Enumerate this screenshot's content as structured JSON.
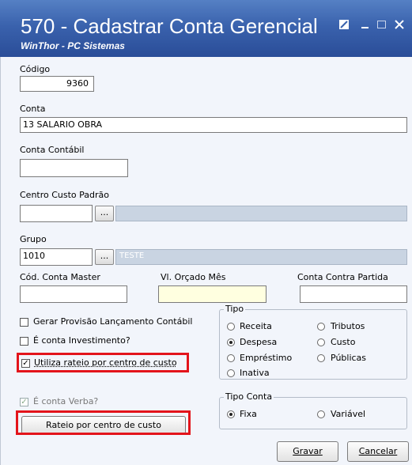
{
  "window": {
    "title": "570 - Cadastrar Conta Gerencial",
    "subtitle": "WinThor - PC Sistemas",
    "controls": [
      "edit-icon",
      "minimize-icon",
      "maximize-icon",
      "close-icon"
    ]
  },
  "fields": {
    "codigo_label": "Código",
    "codigo_value": "9360",
    "conta_label": "Conta",
    "conta_value": "13 SALARIO OBRA",
    "conta_contabil_label": "Conta Contábil",
    "conta_contabil_value": "",
    "centro_custo_label": "Centro Custo Padrão",
    "centro_custo_value": "",
    "centro_custo_desc": "",
    "grupo_label": "Grupo",
    "grupo_value": "1010",
    "grupo_desc": "TESTE",
    "lookup_button": "...",
    "cod_conta_master_label": "Cód. Conta Master",
    "cod_conta_master_value": "",
    "vl_orcado_label": "Vl. Orçado Mês",
    "vl_orcado_value": "",
    "conta_contra_label": "Conta Contra Partida",
    "conta_contra_value": ""
  },
  "checkboxes": {
    "gerar_provisao": {
      "label": "Gerar Provisão Lançamento Contábil",
      "checked": false
    },
    "conta_investimento": {
      "label": "É conta Investimento?",
      "checked": false
    },
    "utiliza_rateio": {
      "label": "Utiliza rateio por centro de custo",
      "checked": true
    },
    "conta_verba": {
      "label": "É conta Verba?",
      "checked": true
    }
  },
  "check_mark": "✓",
  "tipo": {
    "legend": "Tipo",
    "options": [
      "Receita",
      "Tributos",
      "Despesa",
      "Custo",
      "Empréstimo",
      "Públicas",
      "Inativa"
    ],
    "selected": "Despesa"
  },
  "tipo_conta": {
    "legend": "Tipo Conta",
    "options": [
      "Fixa",
      "Variável"
    ],
    "selected": "Fixa"
  },
  "buttons": {
    "rateio": "Rateio por centro de custo",
    "gravar": "Gravar",
    "cancelar": "Cancelar"
  },
  "highlight_color": "#e3141b"
}
